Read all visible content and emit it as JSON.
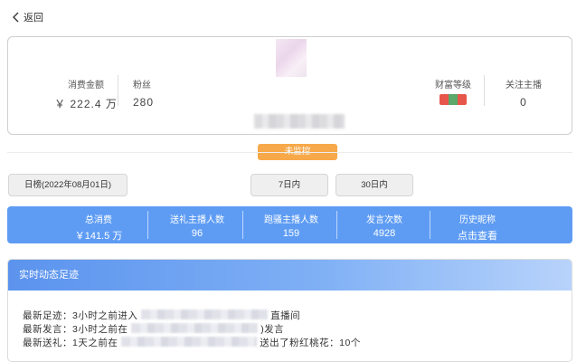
{
  "nav": {
    "back_label": "返回"
  },
  "profile": {
    "spend_label": "消费金额",
    "spend_value": "￥ 222.4 万",
    "fans_label": "粉丝",
    "fans_value": "280",
    "monitor_badge": "未监控",
    "wealth_label": "财富等级",
    "wealth_icon": "wealth-level-badge",
    "follow_label": "关注主播",
    "follow_value": "0"
  },
  "range_buttons": {
    "daily": "日榜(2022年08月01日)",
    "week": "7日内",
    "month": "30日内"
  },
  "stats_bar": {
    "total_label": "总消费",
    "total_value": "￥141.5 万",
    "gift_label": "送礼主播人数",
    "gift_value": "96",
    "visit_label": "跑骚主播人数",
    "visit_value": "159",
    "speech_label": "发言次数",
    "speech_value": "4928",
    "nick_label": "历史昵称",
    "nick_value": "点击查看"
  },
  "activity": {
    "title": "实时动态足迹",
    "track_prefix": "最新足迹：3小时之前进入",
    "track_suffix": "直播间",
    "speech_prefix": "最新发言：3小时之前在",
    "speech_suffix": ")发言",
    "gift_prefix": "最新送礼：1天之前在",
    "gift_suffix": "送出了粉红桃花：10个"
  },
  "colors": {
    "accent_blue": "#5e9cf4",
    "badge_orange": "#f7a94a"
  }
}
